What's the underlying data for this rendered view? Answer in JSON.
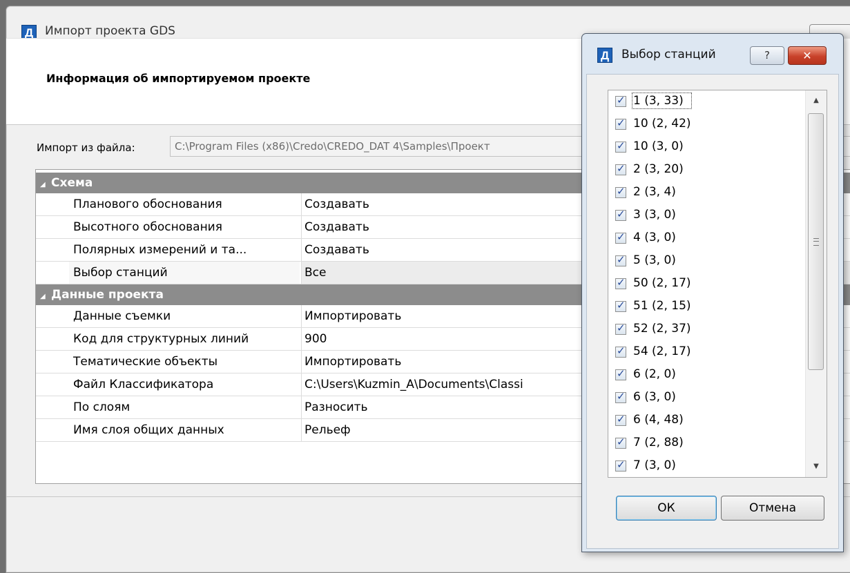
{
  "main": {
    "title": "Импорт проекта GDS",
    "app_icon": "Д",
    "info_heading": "Информация об импортируемом проекте",
    "file_label": "Импорт из файла:",
    "file_path": "C:\\Program Files (x86)\\Credo\\CREDO_DAT 4\\Samples\\Проект",
    "categories": [
      {
        "name": "Схема",
        "rows": [
          {
            "name": "Планового обоснования",
            "value": "Создавать"
          },
          {
            "name": "Высотного обоснования",
            "value": "Создавать"
          },
          {
            "name": "Полярных измерений и та...",
            "value": "Создавать"
          },
          {
            "name": "Выбор станций",
            "value": "Все"
          }
        ]
      },
      {
        "name": "Данные проекта",
        "rows": [
          {
            "name": "Данные съемки",
            "value": "Импортировать"
          },
          {
            "name": "Код для структурных линий",
            "value": "900"
          },
          {
            "name": "Тематические объекты",
            "value": "Импортировать"
          },
          {
            "name": "Файл Классификатора",
            "value": "C:\\Users\\Kuzmin_A\\Documents\\Classi"
          },
          {
            "name": "По слоям",
            "value": "Разносить"
          },
          {
            "name": "Имя слоя общих данных",
            "value": "Рельеф"
          }
        ]
      }
    ]
  },
  "dialog": {
    "title": "Выбор станций",
    "app_icon": "Д",
    "help_label": "?",
    "close_label": "✕",
    "stations": [
      "1 (3, 33)",
      "10 (2, 42)",
      "10 (3, 0)",
      "2 (3, 20)",
      "2 (3, 4)",
      "3 (3, 0)",
      "4 (3, 0)",
      "5 (3, 0)",
      "50 (2, 17)",
      "51 (2, 15)",
      "52 (2, 37)",
      "54 (2, 17)",
      "6 (2, 0)",
      "6 (3, 0)",
      "6 (4, 48)",
      "7 (2, 88)",
      "7 (3, 0)"
    ],
    "ok_label": "ОК",
    "cancel_label": "Отмена"
  }
}
